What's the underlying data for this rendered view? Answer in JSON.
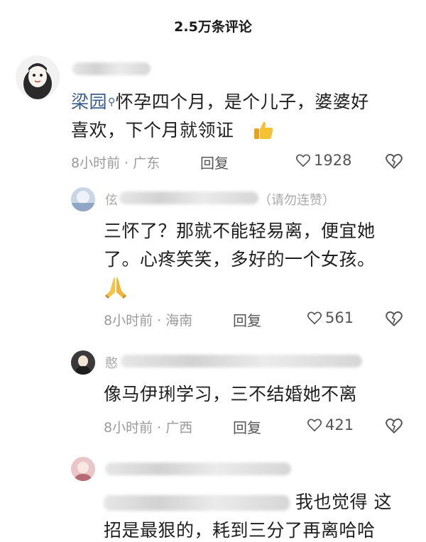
{
  "header": {
    "title": "2.5万条评论"
  },
  "comments": [
    {
      "mention": "梁园",
      "body_line1": "怀孕四个月，是个儿子，婆婆好",
      "body_line2": "喜欢，下个月就领证",
      "time_location": "8小时前 · 广东",
      "reply_label": "回复",
      "likes": "1928"
    }
  ],
  "replies": [
    {
      "username_prefix": "伭",
      "tag": "（请勿连赞）",
      "body_line1": "三怀了？那就不能轻易离，便宜她",
      "body_line2": "了。心疼笑笑，多好的一个女孩。",
      "time_location": "8小时前 · 海南",
      "reply_label": "回复",
      "likes": "561"
    },
    {
      "username_prefix": "憨",
      "body_line1": "像马伊琍学习，三不结婚她不离",
      "time_location": "8小时前 · 广西",
      "reply_label": "回复",
      "likes": "421"
    },
    {
      "body_line1_tail": "我也觉得 这",
      "body_line2": "招是最狠的，耗到三分了再离哈哈"
    }
  ],
  "icons": {
    "like": "heart-outline-icon",
    "dislike": "broken-heart-icon",
    "search_mini": "search-mini-icon",
    "thumbs_up": "thumbs-up-emoji",
    "pray": "folded-hands-emoji"
  },
  "colors": {
    "mention": "#3b5e8f",
    "meta": "#9a9a9a",
    "text": "#1f1f1f"
  }
}
